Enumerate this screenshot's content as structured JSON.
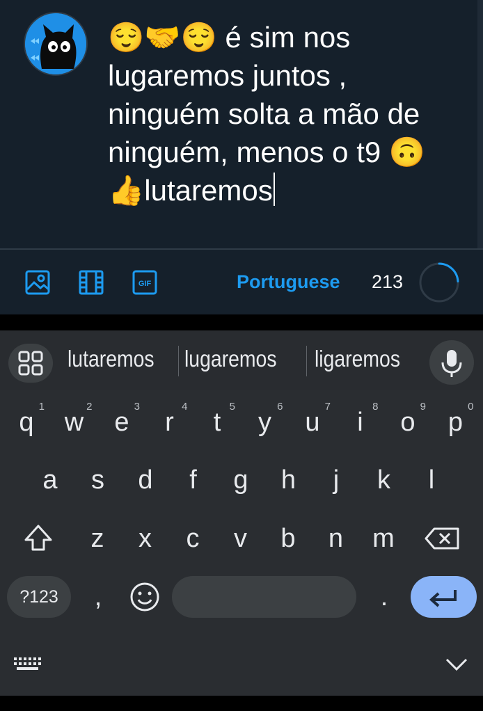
{
  "compose": {
    "text": "😌🤝😌 é sim nos lugaremos juntos , ninguém solta a mão de ninguém, menos o t9 🙃👍lutaremos",
    "language": "Portuguese",
    "char_count": "213",
    "progress_fraction": 0.24,
    "accent": "#1d9bf0",
    "toolbar_icons": [
      "image-icon",
      "video-icon",
      "gif-icon"
    ],
    "gif_label": "GIF"
  },
  "keyboard": {
    "suggestions": [
      "lutaremos",
      "lugaremos",
      "ligaremos"
    ],
    "row1": [
      {
        "key": "q",
        "hint": "1"
      },
      {
        "key": "w",
        "hint": "2"
      },
      {
        "key": "e",
        "hint": "3"
      },
      {
        "key": "r",
        "hint": "4"
      },
      {
        "key": "t",
        "hint": "5"
      },
      {
        "key": "y",
        "hint": "6"
      },
      {
        "key": "u",
        "hint": "7"
      },
      {
        "key": "i",
        "hint": "8"
      },
      {
        "key": "o",
        "hint": "9"
      },
      {
        "key": "p",
        "hint": "0"
      }
    ],
    "row2": [
      "a",
      "s",
      "d",
      "f",
      "g",
      "h",
      "j",
      "k",
      "l"
    ],
    "row3": [
      "z",
      "x",
      "c",
      "v",
      "b",
      "n",
      "m"
    ],
    "symbols_label": "?123",
    "comma": ",",
    "period": ".",
    "enter_color": "#8ab4f8"
  }
}
